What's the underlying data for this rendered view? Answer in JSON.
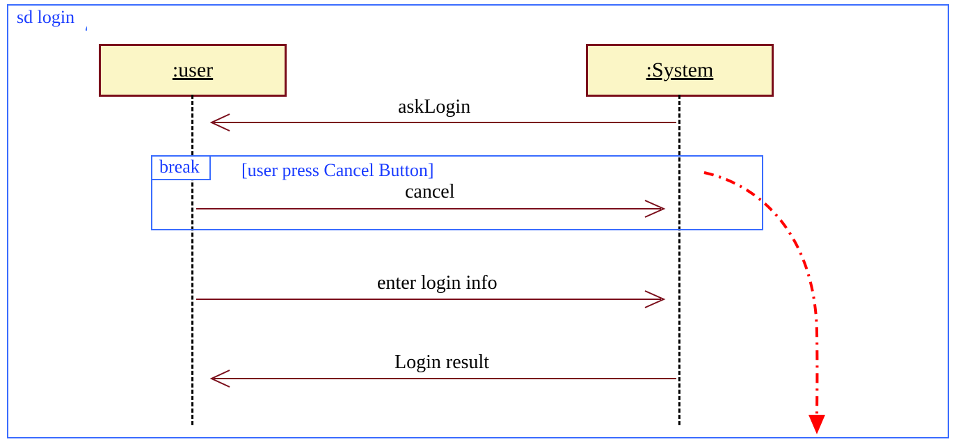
{
  "diagram": {
    "frameLabel": "sd login",
    "lifelines": {
      "user": ":user",
      "system": ":System"
    },
    "fragment": {
      "operator": "break",
      "guard": "[user press Cancel Button]"
    },
    "messages": {
      "askLogin": "askLogin",
      "cancel": "cancel",
      "enterLoginInfo": "enter login info",
      "loginResult": "Login result"
    }
  }
}
